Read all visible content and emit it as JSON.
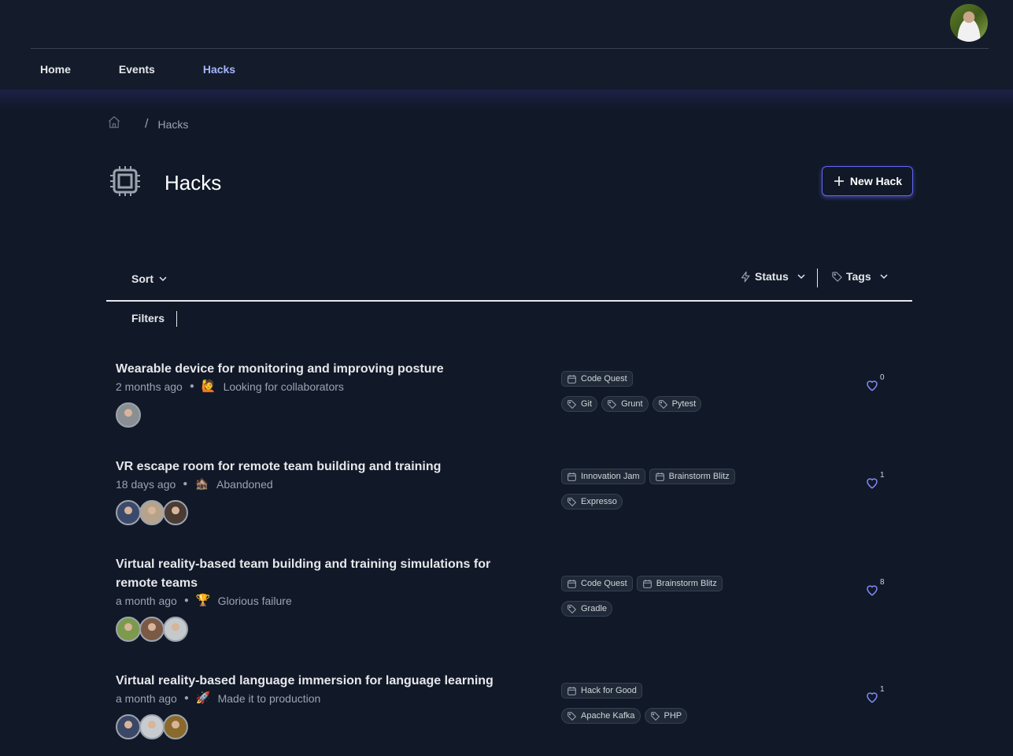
{
  "header": {
    "user_avatar": "user-avatar",
    "nav": [
      {
        "label": "Home",
        "active": false
      },
      {
        "label": "Events",
        "active": false
      },
      {
        "label": "Hacks",
        "active": true
      }
    ]
  },
  "breadcrumb": {
    "home_icon": "home-icon",
    "separator": "/",
    "current": "Hacks"
  },
  "page": {
    "icon": "chip-icon",
    "title": "Hacks",
    "new_button_label": "New Hack"
  },
  "toolbar": {
    "sort_label": "Sort",
    "status_label": "Status",
    "tags_label": "Tags",
    "filters_label": "Filters"
  },
  "colors": {
    "accent": "#a5b4fc",
    "button_border": "#6366f1",
    "background": "#111827"
  },
  "hacks": [
    {
      "title": "Wearable device for monitoring and improving posture",
      "time": "2 months ago",
      "status_emoji": "🙋",
      "status": "Looking for collaborators",
      "members": 1,
      "events": [
        "Code Quest"
      ],
      "tags": [
        "Git",
        "Grunt",
        "Pytest"
      ],
      "likes": "0"
    },
    {
      "title": "VR escape room for remote team building and training",
      "time": "18 days ago",
      "status_emoji": "🏚️",
      "status": "Abandoned",
      "members": 3,
      "events": [
        "Innovation Jam",
        "Brainstorm Blitz"
      ],
      "tags": [
        "Expresso"
      ],
      "likes": "1"
    },
    {
      "title": "Virtual reality-based team building and training simulations for remote teams",
      "time": "a month ago",
      "status_emoji": "🏆",
      "status": "Glorious failure",
      "members": 3,
      "events": [
        "Code Quest",
        "Brainstorm Blitz"
      ],
      "tags": [
        "Gradle"
      ],
      "likes": "8"
    },
    {
      "title": "Virtual reality-based language immersion for language learning",
      "time": "a month ago",
      "status_emoji": "🚀",
      "status": "Made it to production",
      "members": 3,
      "events": [
        "Hack for Good"
      ],
      "tags": [
        "Apache Kafka",
        "PHP"
      ],
      "likes": "1"
    }
  ]
}
